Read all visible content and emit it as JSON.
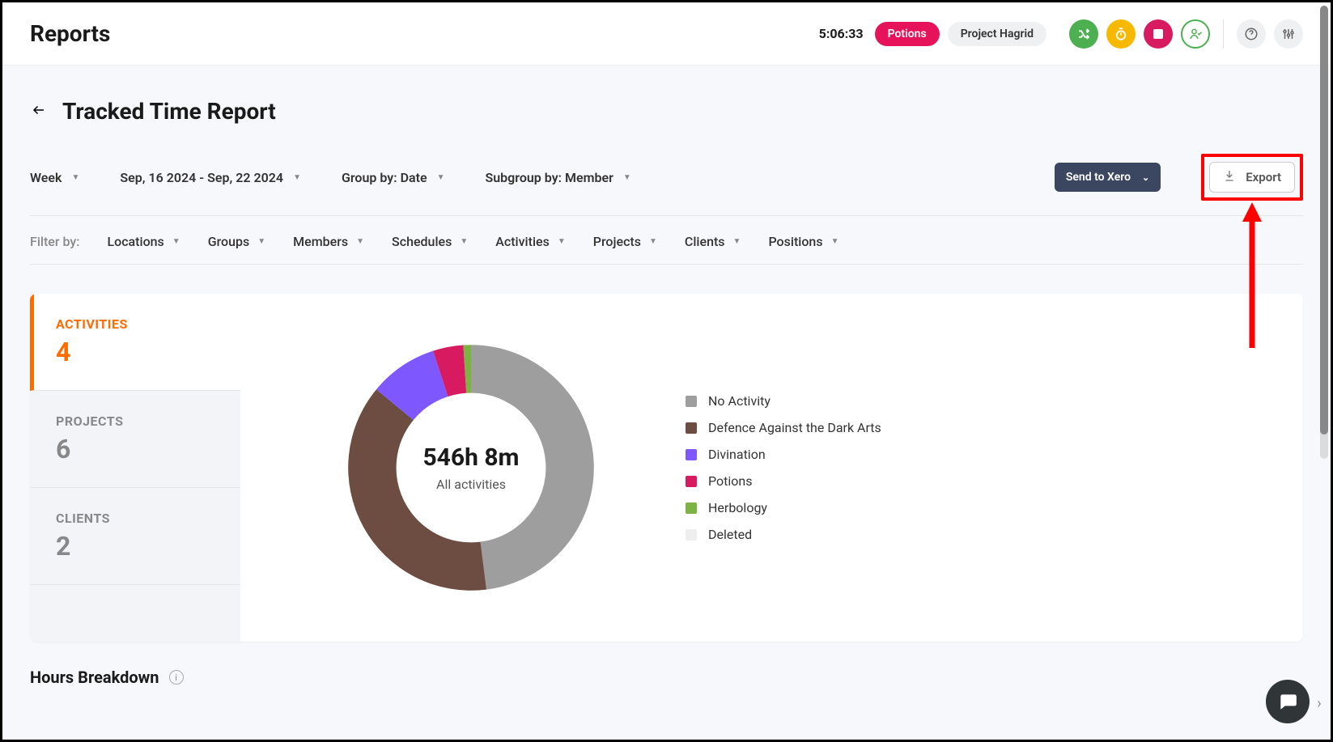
{
  "header": {
    "page_title": "Reports",
    "timer": "5:06:33",
    "pill_activity": "Potions",
    "pill_project": "Project Hagrid"
  },
  "report": {
    "title": "Tracked Time Report"
  },
  "controls": {
    "period_label": "Week",
    "date_range": "Sep, 16 2024 - Sep, 22 2024",
    "group_by": "Group by: Date",
    "subgroup_by": "Subgroup by: Member",
    "send_to_xero": "Send to Xero",
    "export_label": "Export"
  },
  "filters": {
    "label": "Filter by:",
    "items": [
      "Locations",
      "Groups",
      "Members",
      "Schedules",
      "Activities",
      "Projects",
      "Clients",
      "Positions"
    ]
  },
  "tabs": [
    {
      "title": "ACTIVITIES",
      "count": "4"
    },
    {
      "title": "PROJECTS",
      "count": "6"
    },
    {
      "title": "CLIENTS",
      "count": "2"
    }
  ],
  "donut": {
    "total_label": "546h 8m",
    "subtitle": "All activities"
  },
  "legend_labels": {
    "No Activity": "No Activity",
    "Defence Against the Dark Arts": "Defence Against the Dark Arts",
    "Divination": "Divination",
    "Potions": "Potions",
    "Herbology": "Herbology",
    "Deleted": "Deleted"
  },
  "chart_data": {
    "type": "pie",
    "title": "All activities",
    "total": "546h 8m",
    "series": [
      {
        "name": "No Activity",
        "percent": 48,
        "color": "#9e9e9e"
      },
      {
        "name": "Defence Against the Dark Arts",
        "percent": 38,
        "color": "#6d4c41"
      },
      {
        "name": "Divination",
        "percent": 9,
        "color": "#7e57ff"
      },
      {
        "name": "Potions",
        "percent": 4,
        "color": "#d81b60"
      },
      {
        "name": "Herbology",
        "percent": 1,
        "color": "#7cb342"
      },
      {
        "name": "Deleted",
        "percent": 0,
        "color": "#eeeeee"
      }
    ]
  },
  "breakdown": {
    "title": "Hours Breakdown"
  }
}
